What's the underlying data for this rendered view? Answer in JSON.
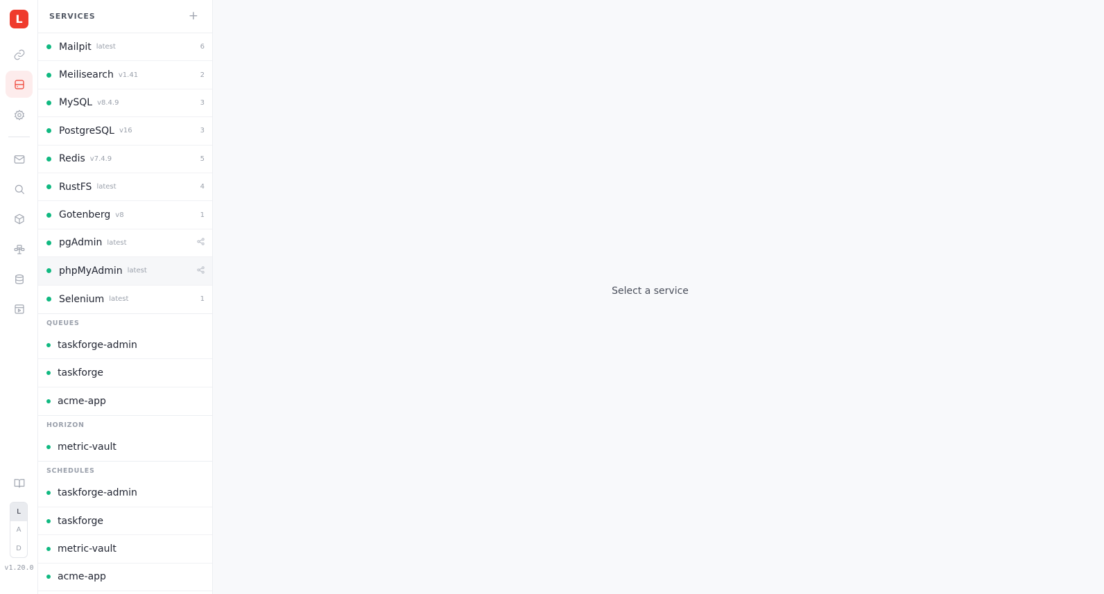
{
  "rail": {
    "logo": "L",
    "workspaces": [
      "L",
      "A",
      "D"
    ],
    "version": "v1.20.0"
  },
  "services": {
    "title": "SERVICES",
    "items": [
      {
        "name": "Mailpit",
        "version": "latest",
        "count": "6"
      },
      {
        "name": "Meilisearch",
        "version": "v1.41",
        "count": "2"
      },
      {
        "name": "MySQL",
        "version": "v8.4.9",
        "count": "3"
      },
      {
        "name": "PostgreSQL",
        "version": "v16",
        "count": "3"
      },
      {
        "name": "Redis",
        "version": "v7.4.9",
        "count": "5"
      },
      {
        "name": "RustFS",
        "version": "latest",
        "count": "4"
      },
      {
        "name": "Gotenberg",
        "version": "v8",
        "count": "1"
      },
      {
        "name": "pgAdmin",
        "version": "latest",
        "count": ""
      },
      {
        "name": "phpMyAdmin",
        "version": "latest",
        "count": ""
      },
      {
        "name": "Selenium",
        "version": "latest",
        "count": "1"
      }
    ]
  },
  "queues": {
    "title": "QUEUES",
    "items": [
      "taskforge-admin",
      "taskforge",
      "acme-app"
    ]
  },
  "horizon": {
    "title": "HORIZON",
    "items": [
      "metric-vault"
    ]
  },
  "schedules": {
    "title": "SCHEDULES",
    "items": [
      "taskforge-admin",
      "taskforge",
      "metric-vault",
      "acme-app"
    ]
  },
  "main": {
    "empty_text": "Select a service"
  },
  "colors": {
    "accent": "#ef3b2d",
    "status_green": "#10b981"
  }
}
